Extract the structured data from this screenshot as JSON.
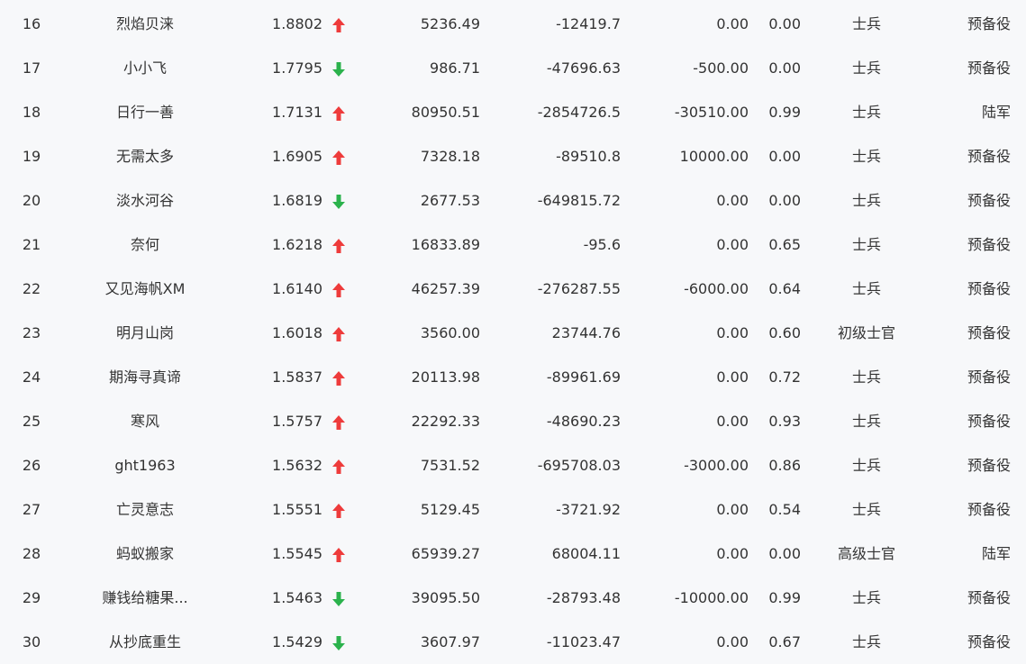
{
  "colors": {
    "up": "#ee3b3b",
    "down": "#2bb24c",
    "text": "#333333",
    "background": "#f7f8fa"
  },
  "rows": [
    {
      "rank": "16",
      "name": "烈焰贝涞",
      "score": "1.8802",
      "trend": "up",
      "v1": "5236.49",
      "v2": "-12419.7",
      "v3": "0.00",
      "v4": "0.00",
      "level": "士兵",
      "unit": "预备役"
    },
    {
      "rank": "17",
      "name": "小小飞",
      "score": "1.7795",
      "trend": "down",
      "v1": "986.71",
      "v2": "-47696.63",
      "v3": "-500.00",
      "v4": "0.00",
      "level": "士兵",
      "unit": "预备役"
    },
    {
      "rank": "18",
      "name": "日行一善",
      "score": "1.7131",
      "trend": "up",
      "v1": "80950.51",
      "v2": "-2854726.5",
      "v3": "-30510.00",
      "v4": "0.99",
      "level": "士兵",
      "unit": "陆军"
    },
    {
      "rank": "19",
      "name": "无需太多",
      "score": "1.6905",
      "trend": "up",
      "v1": "7328.18",
      "v2": "-89510.8",
      "v3": "10000.00",
      "v4": "0.00",
      "level": "士兵",
      "unit": "预备役"
    },
    {
      "rank": "20",
      "name": "淡水河谷",
      "score": "1.6819",
      "trend": "down",
      "v1": "2677.53",
      "v2": "-649815.72",
      "v3": "0.00",
      "v4": "0.00",
      "level": "士兵",
      "unit": "预备役"
    },
    {
      "rank": "21",
      "name": "奈何",
      "score": "1.6218",
      "trend": "up",
      "v1": "16833.89",
      "v2": "-95.6",
      "v3": "0.00",
      "v4": "0.65",
      "level": "士兵",
      "unit": "预备役"
    },
    {
      "rank": "22",
      "name": "又见海帆XM",
      "score": "1.6140",
      "trend": "up",
      "v1": "46257.39",
      "v2": "-276287.55",
      "v3": "-6000.00",
      "v4": "0.64",
      "level": "士兵",
      "unit": "预备役"
    },
    {
      "rank": "23",
      "name": "明月山岗",
      "score": "1.6018",
      "trend": "up",
      "v1": "3560.00",
      "v2": "23744.76",
      "v3": "0.00",
      "v4": "0.60",
      "level": "初级士官",
      "unit": "预备役"
    },
    {
      "rank": "24",
      "name": "期海寻真谛",
      "score": "1.5837",
      "trend": "up",
      "v1": "20113.98",
      "v2": "-89961.69",
      "v3": "0.00",
      "v4": "0.72",
      "level": "士兵",
      "unit": "预备役"
    },
    {
      "rank": "25",
      "name": "寒风",
      "score": "1.5757",
      "trend": "up",
      "v1": "22292.33",
      "v2": "-48690.23",
      "v3": "0.00",
      "v4": "0.93",
      "level": "士兵",
      "unit": "预备役"
    },
    {
      "rank": "26",
      "name": "ght1963",
      "score": "1.5632",
      "trend": "up",
      "v1": "7531.52",
      "v2": "-695708.03",
      "v3": "-3000.00",
      "v4": "0.86",
      "level": "士兵",
      "unit": "预备役"
    },
    {
      "rank": "27",
      "name": "亡灵意志",
      "score": "1.5551",
      "trend": "up",
      "v1": "5129.45",
      "v2": "-3721.92",
      "v3": "0.00",
      "v4": "0.54",
      "level": "士兵",
      "unit": "预备役"
    },
    {
      "rank": "28",
      "name": "蚂蚁搬家",
      "score": "1.5545",
      "trend": "up",
      "v1": "65939.27",
      "v2": "68004.11",
      "v3": "0.00",
      "v4": "0.00",
      "level": "高级士官",
      "unit": "陆军"
    },
    {
      "rank": "29",
      "name": "赚钱给糖果...",
      "score": "1.5463",
      "trend": "down",
      "v1": "39095.50",
      "v2": "-28793.48",
      "v3": "-10000.00",
      "v4": "0.99",
      "level": "士兵",
      "unit": "预备役"
    },
    {
      "rank": "30",
      "name": "从抄底重生",
      "score": "1.5429",
      "trend": "down",
      "v1": "3607.97",
      "v2": "-11023.47",
      "v3": "0.00",
      "v4": "0.67",
      "level": "士兵",
      "unit": "预备役"
    }
  ]
}
